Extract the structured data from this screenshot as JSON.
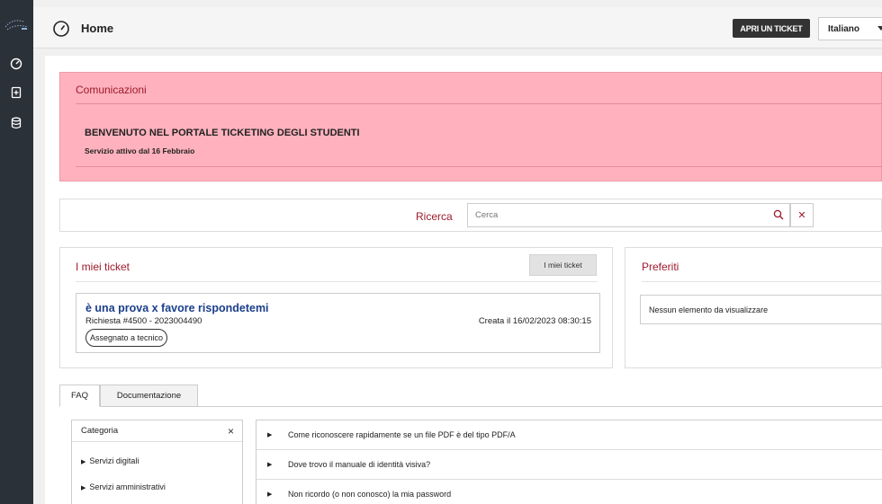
{
  "header": {
    "title": "Home",
    "ticket_button": "APRI UN TICKET",
    "language": "Italiano"
  },
  "communications": {
    "title": "Comunicazioni",
    "heading": "BENVENUTO NEL PORTALE TICKETING DEGLI STUDENTI",
    "subtitle": "Servizio attivo dal 16 Febbraio"
  },
  "search": {
    "label": "Ricerca",
    "placeholder": "Cerca"
  },
  "tickets": {
    "title": "I miei ticket",
    "button": "I miei ticket",
    "items": [
      {
        "name": "è una prova x favore rispondetemi",
        "number": "Richiesta #4500 - 2023004490",
        "created": "Creata il 16/02/2023 08:30:15",
        "status": "Assegnato a tecnico"
      }
    ]
  },
  "favorites": {
    "title": "Preferiti",
    "empty": "Nessun elemento da visualizzare"
  },
  "tabs": [
    {
      "label": "FAQ"
    },
    {
      "label": "Documentazione"
    }
  ],
  "categories": {
    "title": "Categoria",
    "items": [
      "Servizi digitali",
      "Servizi amministrativi"
    ]
  },
  "faq": [
    "Come riconoscere rapidamente se un file PDF è del tipo PDF/A",
    "Dove trovo il manuale di identità visiva?",
    "Non ricordo (o non conosco) la mia password"
  ],
  "colors": {
    "accent": "#9d1a2c",
    "link": "#1b3f8b",
    "notice_bg": "#ffb2bd",
    "sidebar_bg": "#2b3138"
  }
}
